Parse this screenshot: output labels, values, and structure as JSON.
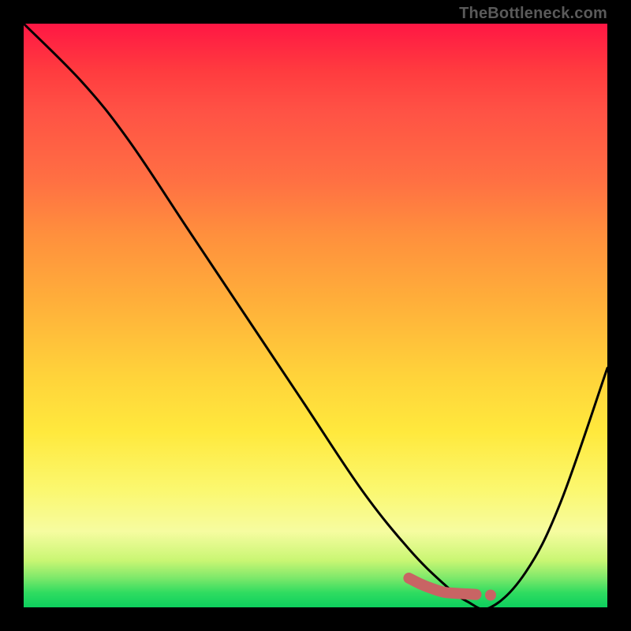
{
  "watermark": "TheBottleneck.com",
  "colors": {
    "curve_stroke": "#000000",
    "marker_stroke": "#c86464",
    "marker_fill": "#c86464"
  },
  "chart_data": {
    "type": "line",
    "title": "",
    "xlabel": "",
    "ylabel": "",
    "xlim": [
      0,
      100
    ],
    "ylim": [
      0,
      100
    ],
    "grid": false,
    "legend": false,
    "series": [
      {
        "name": "bottleneck-curve",
        "x": [
          0,
          10,
          18,
          28,
          38,
          48,
          58,
          66,
          72,
          76,
          80,
          86,
          92,
          100
        ],
        "y": [
          100,
          90,
          80,
          65,
          50,
          35,
          20,
          10,
          4,
          1,
          0,
          6,
          18,
          41
        ]
      }
    ],
    "markers": [
      {
        "name": "highlight-segment",
        "x": [
          66,
          68,
          70,
          72,
          74,
          76,
          77.5
        ],
        "y": [
          5,
          4,
          3.2,
          2.6,
          2.4,
          2.3,
          2.2
        ]
      },
      {
        "name": "highlight-dot",
        "x": [
          80
        ],
        "y": [
          2.1
        ]
      }
    ]
  }
}
